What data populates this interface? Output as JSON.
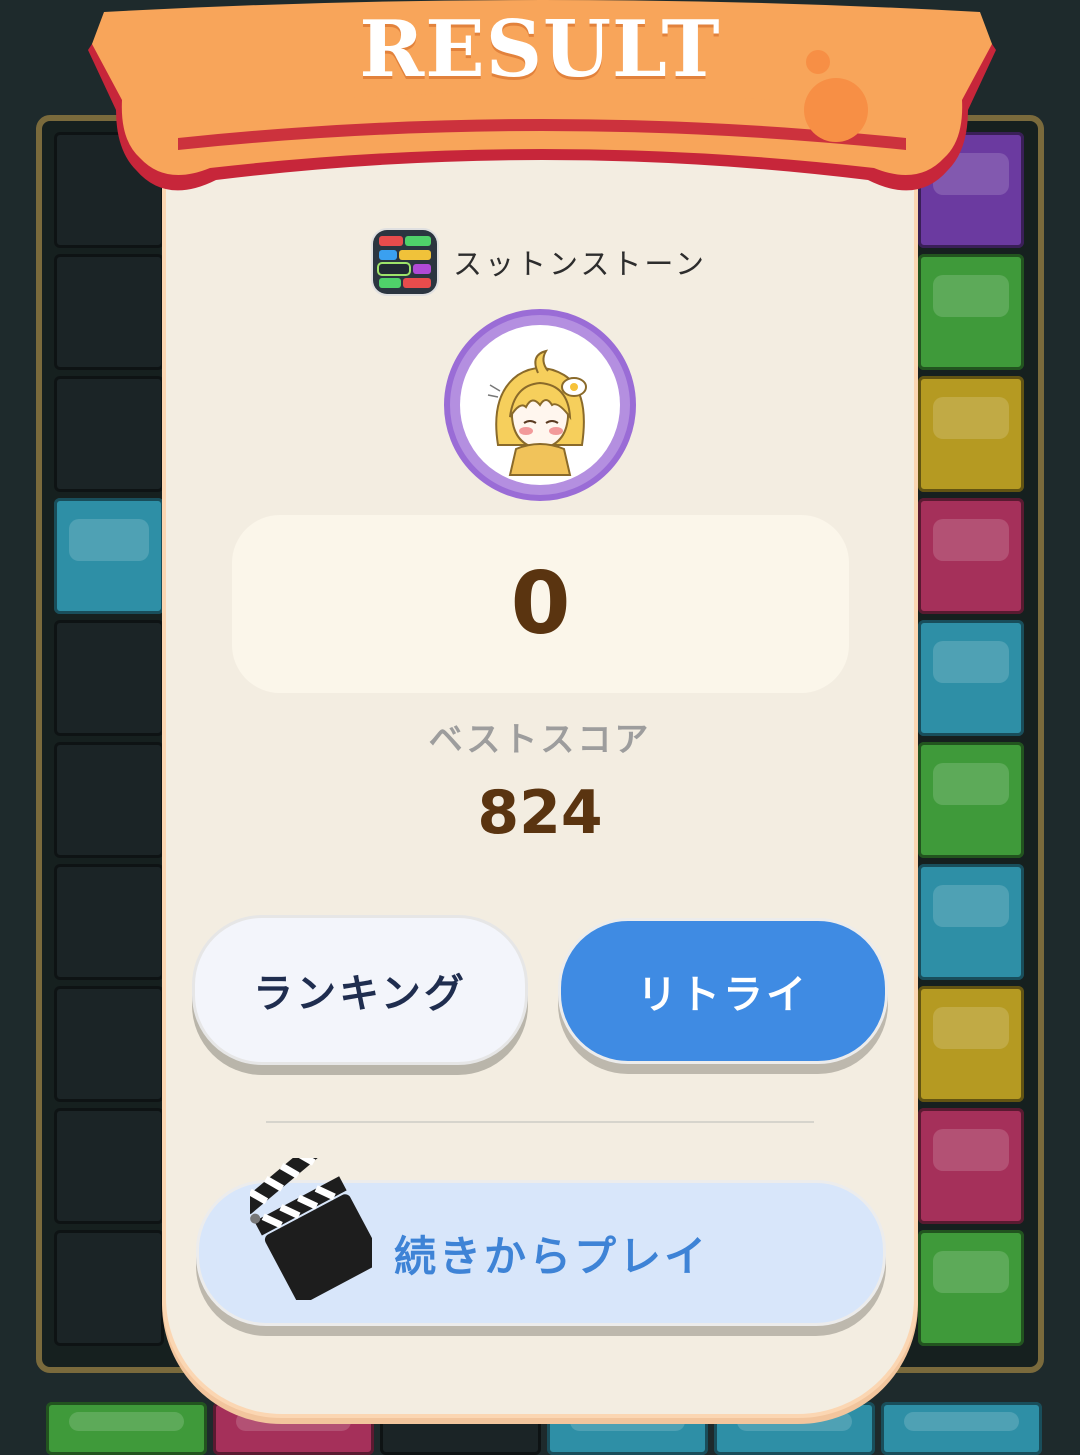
{
  "ribbon": {
    "title": "RESULT"
  },
  "game": {
    "name": "スットンストーン",
    "icon": "block-puzzle-app-icon"
  },
  "player": {
    "avatar": "yellow-haired-chibi-avatar"
  },
  "score": {
    "current": "0",
    "best_label": "ベストスコア",
    "best_value": "824"
  },
  "buttons": {
    "ranking": "ランキング",
    "retry": "リトライ",
    "continue": "続きからプレイ"
  },
  "colors": {
    "ribbon": "#f8a55a",
    "ribbon_edge": "#c7263a",
    "retry_button": "#3f8be3",
    "continue_button": "#d8e6fa",
    "score_text": "#5a3410",
    "avatar_ring": "#9a6cd6"
  }
}
